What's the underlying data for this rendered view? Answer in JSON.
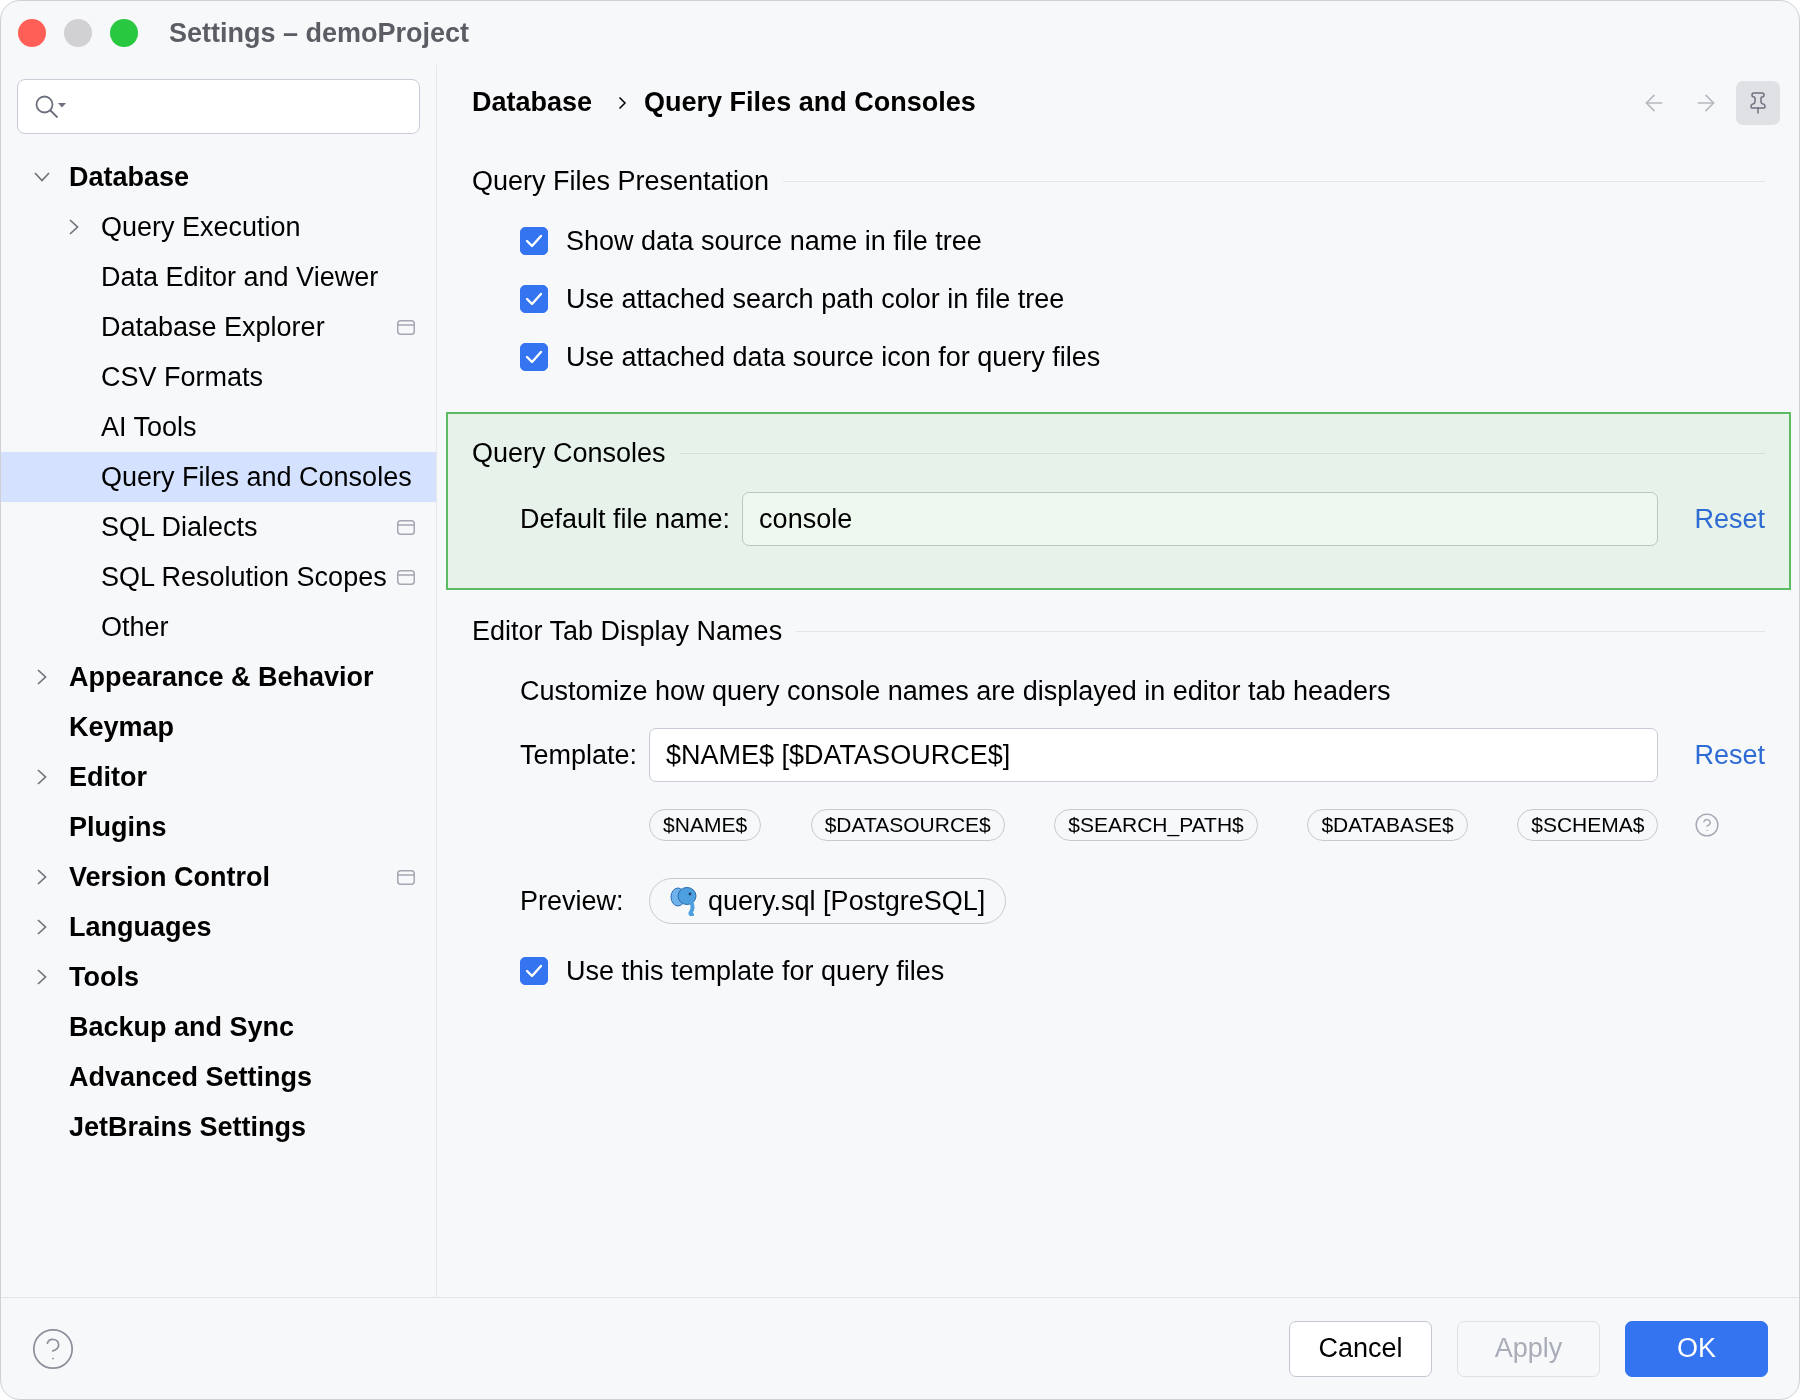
{
  "window": {
    "title": "Settings – demoProject",
    "controls": [
      {
        "kind": "close",
        "disabled": false
      },
      {
        "kind": "minimize",
        "disabled": true
      },
      {
        "kind": "zoom",
        "disabled": false
      }
    ]
  },
  "sidebar": {
    "items": [
      {
        "label": "Database",
        "expanded": true,
        "selected": false,
        "project_level": false,
        "children": [
          {
            "label": "Query Execution",
            "expanded": false,
            "selected": false,
            "project_level": false
          },
          {
            "label": "Data Editor and Viewer",
            "selected": false,
            "project_level": false
          },
          {
            "label": "Database Explorer",
            "selected": false,
            "project_level": true
          },
          {
            "label": "CSV Formats",
            "selected": false,
            "project_level": false
          },
          {
            "label": "AI Tools",
            "selected": false,
            "project_level": false
          },
          {
            "label": "Query Files and Consoles",
            "selected": true,
            "project_level": false
          },
          {
            "label": "SQL Dialects",
            "selected": false,
            "project_level": true
          },
          {
            "label": "SQL Resolution Scopes",
            "selected": false,
            "project_level": true
          },
          {
            "label": "Other",
            "selected": false,
            "project_level": false
          }
        ]
      },
      {
        "label": "Appearance & Behavior",
        "expanded": false,
        "selected": false,
        "project_level": false
      },
      {
        "label": "Keymap",
        "selected": false,
        "project_level": false
      },
      {
        "label": "Editor",
        "expanded": false,
        "selected": false,
        "project_level": false
      },
      {
        "label": "Plugins",
        "selected": false,
        "project_level": false
      },
      {
        "label": "Version Control",
        "expanded": false,
        "selected": false,
        "project_level": true
      },
      {
        "label": "Languages",
        "expanded": false,
        "selected": false,
        "project_level": false
      },
      {
        "label": "Tools",
        "expanded": false,
        "selected": false,
        "project_level": false
      },
      {
        "label": "Backup and Sync",
        "selected": false,
        "project_level": false
      },
      {
        "label": "Advanced Settings",
        "selected": false,
        "project_level": false
      },
      {
        "label": "JetBrains Settings",
        "selected": false,
        "project_level": false
      }
    ]
  },
  "header": {
    "breadcrumb": [
      "Database",
      "Query Files and Consoles"
    ],
    "tools": [
      {
        "kind": "back",
        "disabled": true
      },
      {
        "kind": "forward",
        "disabled": true
      },
      {
        "kind": "pin",
        "disabled": false,
        "on": true
      }
    ]
  },
  "sections": [
    {
      "title": "Query Files Presentation",
      "highlighted": false,
      "rows": [
        {
          "kind": "checkbox",
          "label": "Show data source name in file tree",
          "checked": true
        },
        {
          "kind": "checkbox",
          "label": "Use attached search path color in file tree",
          "checked": true
        },
        {
          "kind": "checkbox",
          "label": "Use attached data source icon for query files",
          "checked": true
        }
      ]
    },
    {
      "title": "Query Consoles",
      "highlighted": true,
      "rows": [
        {
          "kind": "field",
          "label": "Default file name:",
          "value": "console",
          "action": "Reset"
        }
      ]
    },
    {
      "title": "Editor Tab Display Names",
      "highlighted": false,
      "rows": [
        {
          "kind": "text",
          "text": "Customize how query console names are displayed in editor tab headers"
        },
        {
          "kind": "field",
          "label": "Template:",
          "value": "$NAME$ [$DATASOURCE$]",
          "action": "Reset"
        },
        {
          "kind": "chips",
          "chips": [
            "$NAME$",
            "$DATASOURCE$",
            "$SEARCH_PATH$",
            "$DATABASE$",
            "$SCHEMA$"
          ]
        },
        {
          "kind": "preview",
          "label": "Preview:",
          "value": "query.sql [PostgreSQL]"
        },
        {
          "kind": "checkbox",
          "label": "Use this template for query files",
          "checked": true
        }
      ]
    }
  ],
  "footer": {
    "buttons": [
      {
        "label": "Cancel",
        "kind": "secondary",
        "disabled": false
      },
      {
        "label": "Apply",
        "kind": "secondary",
        "disabled": true
      },
      {
        "label": "OK",
        "kind": "primary",
        "disabled": false
      }
    ]
  }
}
